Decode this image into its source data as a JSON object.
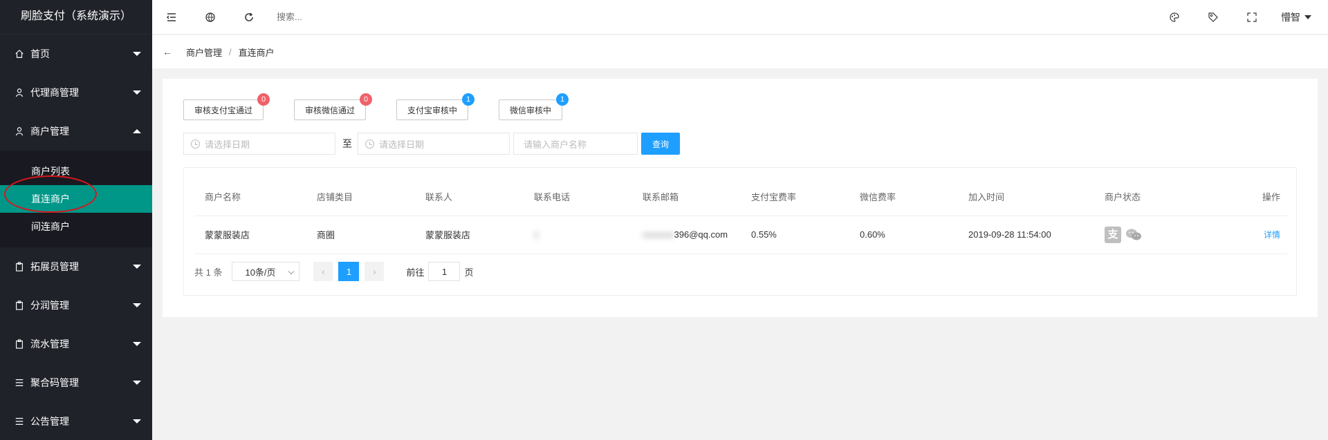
{
  "app": {
    "title": "刷脸支付（系统演示）"
  },
  "sidebar": {
    "items": [
      {
        "label": "首页",
        "icon": "home-icon"
      },
      {
        "label": "代理商管理",
        "icon": "user-icon"
      },
      {
        "label": "商户管理",
        "icon": "user-icon",
        "open": true,
        "children": [
          {
            "label": "商户列表"
          },
          {
            "label": "直连商户",
            "active": true
          },
          {
            "label": "间连商户"
          }
        ]
      },
      {
        "label": "拓展员管理",
        "icon": "clipboard-icon"
      },
      {
        "label": "分润管理",
        "icon": "clipboard-icon"
      },
      {
        "label": "流水管理",
        "icon": "clipboard-icon"
      },
      {
        "label": "聚合码管理",
        "icon": "list-icon"
      },
      {
        "label": "公告管理",
        "icon": "list-icon"
      }
    ]
  },
  "header": {
    "search_placeholder": "搜索...",
    "username": "懵智"
  },
  "breadcrumb": {
    "parent": "商户管理",
    "separator": "/",
    "current": "直连商户"
  },
  "status_buttons": [
    {
      "label": "审核支付宝通过",
      "count": "0",
      "color": "#f0616a"
    },
    {
      "label": "审核微信通过",
      "count": "0",
      "color": "#f0616a"
    },
    {
      "label": "支付宝审核中",
      "count": "1",
      "color": "#1e9fff"
    },
    {
      "label": "微信审核中",
      "count": "1",
      "color": "#1e9fff"
    }
  ],
  "filters": {
    "start_placeholder": "请选择日期",
    "to_label": "至",
    "end_placeholder": "请选择日期",
    "name_placeholder": "请输入商户名称",
    "query_label": "查询"
  },
  "table": {
    "columns": [
      "商户名称",
      "店铺类目",
      "联系人",
      "联系电话",
      "联系邮箱",
      "支付宝费率",
      "微信费率",
      "加入时间",
      "商户状态",
      "操作"
    ],
    "rows": [
      {
        "name": "蒙蒙服装店",
        "category": "商圈",
        "contact": "蒙蒙服装店",
        "phone": "1",
        "email": "396@qq.com",
        "alipay_rate": "0.55%",
        "wechat_rate": "0.60%",
        "joined": "2019-09-28 11:54:00",
        "action": "详情"
      }
    ]
  },
  "pager": {
    "total": "共 1 条",
    "page_size": "10条/页",
    "current_page": "1",
    "goto_label": "前往",
    "goto_value": "1",
    "page_suffix": "页"
  }
}
